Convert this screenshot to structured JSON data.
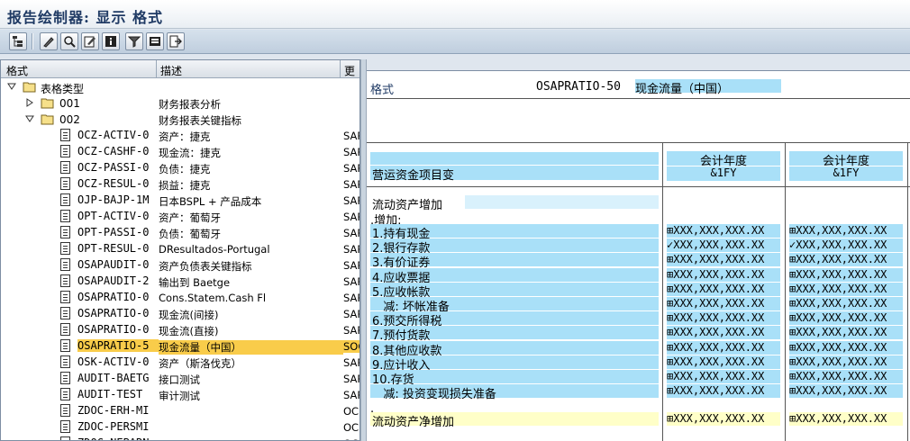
{
  "window": {
    "title": "报告绘制器: 显示 格式"
  },
  "toolbar": {
    "icons": [
      "hierarchy-icon",
      "edit-glasses-icon",
      "find-icon",
      "change-icon",
      "info-icon",
      "filter-icon",
      "display-icon",
      "transport-icon"
    ]
  },
  "tree": {
    "columns": {
      "format": "格式",
      "description": "描述",
      "more": "更"
    },
    "root": {
      "label": "表格类型"
    },
    "groups": [
      {
        "code": "001",
        "desc": "财务报表分析"
      },
      {
        "code": "002",
        "desc": "财务报表关键指标"
      }
    ],
    "items": [
      {
        "code": "OCZ-ACTIV-0",
        "desc": "资产：捷克",
        "more": "SAP"
      },
      {
        "code": "OCZ-CASHF-0",
        "desc": "现金流：捷克",
        "more": "SAP"
      },
      {
        "code": "OCZ-PASSI-0",
        "desc": "负债：捷克",
        "more": "SAP"
      },
      {
        "code": "OCZ-RESUL-0",
        "desc": "损益：捷克",
        "more": "SAP"
      },
      {
        "code": "OJP-BAJP-1M",
        "desc": "日本BSPL + 产品成本",
        "more": "SAP"
      },
      {
        "code": "OPT-ACTIV-0",
        "desc": "资产：葡萄牙",
        "more": "SAP"
      },
      {
        "code": "OPT-PASSI-0",
        "desc": "负债：葡萄牙",
        "more": "SAP"
      },
      {
        "code": "OPT-RESUL-0",
        "desc": "DResultados-Portugal",
        "more": "SAP"
      },
      {
        "code": "OSAPAUDIT-0",
        "desc": "资产负债表关键指标",
        "more": "SAP"
      },
      {
        "code": "OSAPAUDIT-2",
        "desc": "输出到 Baetge",
        "more": "SAP"
      },
      {
        "code": "OSAPRATIO-0",
        "desc": "Cons.Statem.Cash Fl",
        "more": "SAP"
      },
      {
        "code": "OSAPRATIO-0",
        "desc": "现金流(间接)",
        "more": "SAP"
      },
      {
        "code": "OSAPRATIO-0",
        "desc": "现金流(直接)",
        "more": "SAP"
      },
      {
        "code": "OSAPRATIO-5",
        "desc": "现金流量（中国）",
        "more": "SOC",
        "selected": true
      },
      {
        "code": "OSK-ACTIV-0",
        "desc": "资产（斯洛伐克）",
        "more": "SAP"
      },
      {
        "code": "AUDIT-BAETG",
        "desc": "接口测试",
        "more": "SAP"
      },
      {
        "code": "AUDIT-TEST",
        "desc": "审计测试",
        "more": "SAP"
      },
      {
        "code": "ZDOC-ERH-MI",
        "desc": "",
        "more": "OC"
      },
      {
        "code": "ZDOC-PERSMI",
        "desc": "",
        "more": "OC"
      },
      {
        "code": "ZDOC-NEBARN",
        "desc": "",
        "more": "OC"
      }
    ]
  },
  "format": {
    "label": "格式",
    "code": "OSAPRATIO-50",
    "name": "现金流量（中国）",
    "section_header": "营运资金项目变",
    "columns": [
      {
        "title": "会计年度",
        "sub": "&1FY"
      },
      {
        "title": "会计年度",
        "sub": "&1FY"
      }
    ],
    "group_title": "流动资产增加",
    "subgroup": ".增加:",
    "lines": [
      {
        "label": "1.持有现金",
        "v1": "⊞XXX,XXX,XXX.XX",
        "v2": "⊞XXX,XXX,XXX.XX"
      },
      {
        "label": "2.银行存款",
        "v1": "✓XXX,XXX,XXX.XX",
        "v2": "✓XXX,XXX,XXX.XX"
      },
      {
        "label": "3.有价证券",
        "v1": "⊞XXX,XXX,XXX.XX",
        "v2": "⊞XXX,XXX,XXX.XX"
      },
      {
        "label": "4.应收票据",
        "v1": "⊞XXX,XXX,XXX.XX",
        "v2": "⊞XXX,XXX,XXX.XX"
      },
      {
        "label": "5.应收帐款",
        "v1": "⊞XXX,XXX,XXX.XX",
        "v2": "⊞XXX,XXX,XXX.XX"
      },
      {
        "label": "   减: 坏帐准备",
        "v1": "⊞XXX,XXX,XXX.XX",
        "v2": "⊞XXX,XXX,XXX.XX"
      },
      {
        "label": "6.预交所得税",
        "v1": "⊞XXX,XXX,XXX.XX",
        "v2": "⊞XXX,XXX,XXX.XX"
      },
      {
        "label": "7.预付货款",
        "v1": "⊞XXX,XXX,XXX.XX",
        "v2": "⊞XXX,XXX,XXX.XX"
      },
      {
        "label": "8.其他应收款",
        "v1": "⊞XXX,XXX,XXX.XX",
        "v2": "⊞XXX,XXX,XXX.XX"
      },
      {
        "label": "9.应计收入",
        "v1": "⊞XXX,XXX,XXX.XX",
        "v2": "⊞XXX,XXX,XXX.XX"
      },
      {
        "label": "10.存货",
        "v1": "⊞XXX,XXX,XXX.XX",
        "v2": "⊞XXX,XXX,XXX.XX"
      },
      {
        "label": "   减: 投资变现损失准备",
        "v1": "⊞XXX,XXX,XXX.XX",
        "v2": "⊞XXX,XXX,XXX.XX"
      }
    ],
    "dot_line": ".",
    "total": {
      "label": "流动资产净增加",
      "v1": "⊞XXX,XXX,XXX.XX",
      "v2": "⊞XXX,XXX,XXX.XX"
    }
  },
  "colors": {
    "selected": "#f9cc4a",
    "cell_blue": "#a9e0f8",
    "cell_yellow": "#ffffc8",
    "title": "#1f3a64"
  }
}
